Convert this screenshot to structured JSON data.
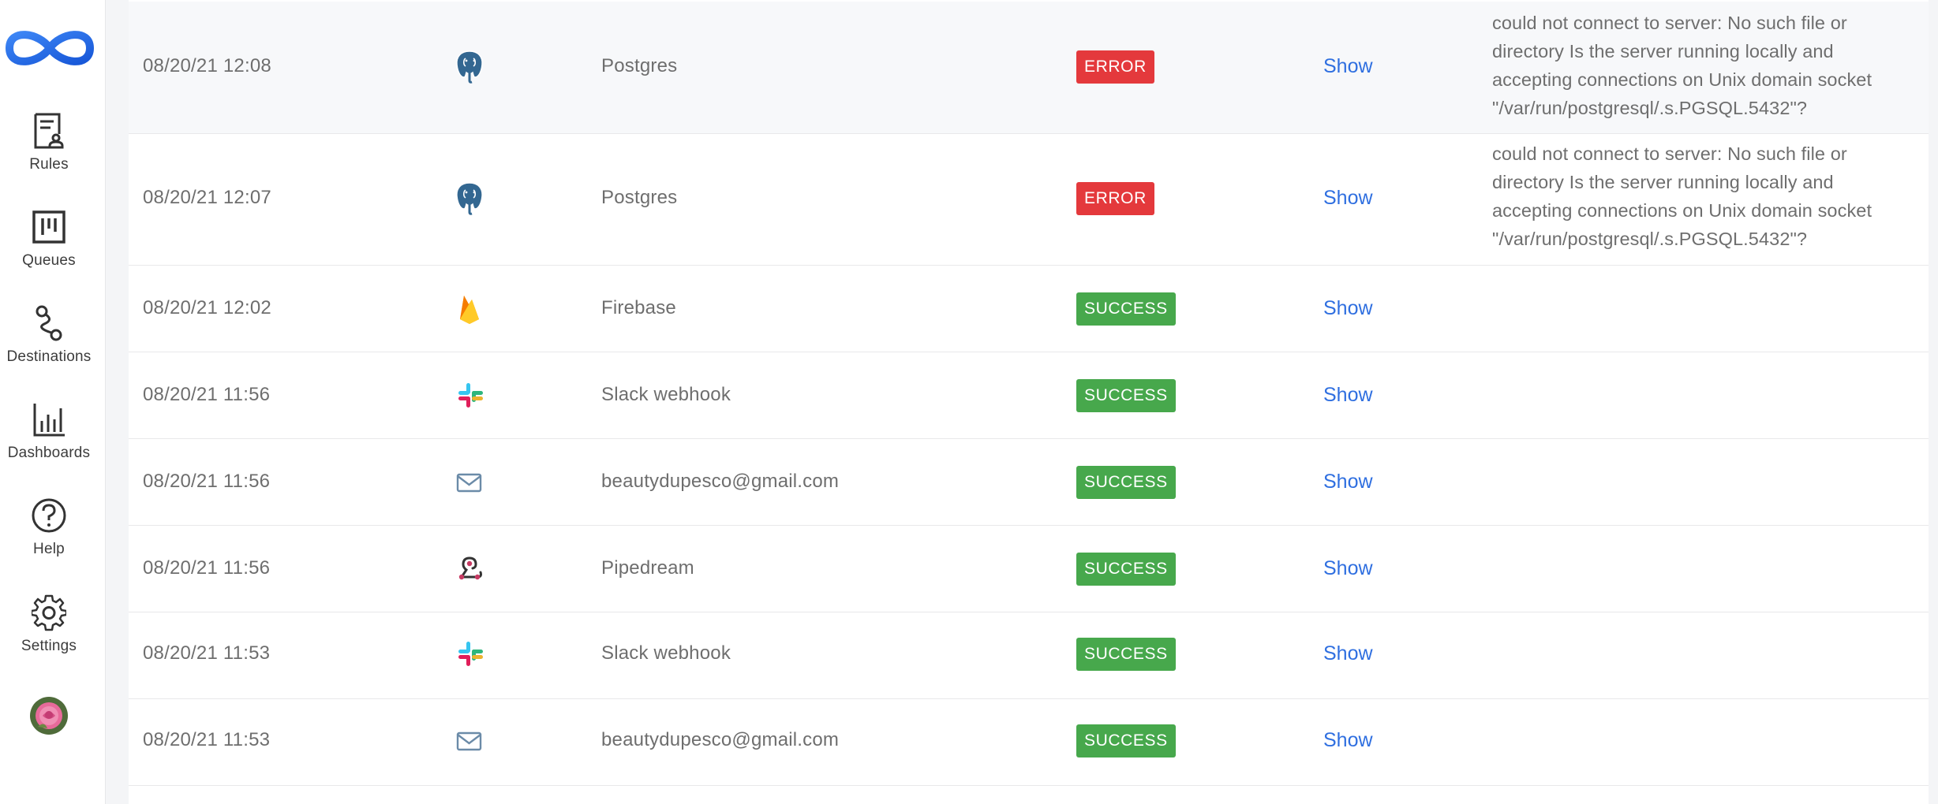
{
  "sidebar": {
    "logo_icon": "infinity-logo-icon",
    "items": [
      {
        "label": "Rules",
        "icon": "rules-icon"
      },
      {
        "label": "Queues",
        "icon": "queues-icon"
      },
      {
        "label": "Destinations",
        "icon": "destinations-icon"
      },
      {
        "label": "Dashboards",
        "icon": "dashboards-icon"
      },
      {
        "label": "Help",
        "icon": "help-icon"
      },
      {
        "label": "Settings",
        "icon": "settings-icon"
      }
    ],
    "avatar_icon": "rose-avatar-icon"
  },
  "colors": {
    "error": "#e4393c",
    "success": "#47a84c",
    "link": "#2f6fe0",
    "logo": "#1f6fe5"
  },
  "log": {
    "rows": [
      {
        "date": "08/20/21 12:08",
        "icon": "postgres-icon",
        "name": "Postgres",
        "status": "ERROR",
        "action": "Show",
        "message": "could not connect to server: No such file or directory Is the server running locally and accepting connections on Unix domain socket \"/var/run/postgresql/.s.PGSQL.5432\"?"
      },
      {
        "date": "08/20/21 12:07",
        "icon": "postgres-icon",
        "name": "Postgres",
        "status": "ERROR",
        "action": "Show",
        "message": "could not connect to server: No such file or directory Is the server running locally and accepting connections on Unix domain socket \"/var/run/postgresql/.s.PGSQL.5432\"?"
      },
      {
        "date": "08/20/21 12:02",
        "icon": "firebase-icon",
        "name": "Firebase",
        "status": "SUCCESS",
        "action": "Show",
        "message": ""
      },
      {
        "date": "08/20/21 11:56",
        "icon": "slack-icon",
        "name": "Slack webhook",
        "status": "SUCCESS",
        "action": "Show",
        "message": ""
      },
      {
        "date": "08/20/21 11:56",
        "icon": "email-icon",
        "name": "beautydupesco@gmail.com",
        "status": "SUCCESS",
        "action": "Show",
        "message": ""
      },
      {
        "date": "08/20/21 11:56",
        "icon": "pipedream-webhook-icon",
        "name": "Pipedream",
        "status": "SUCCESS",
        "action": "Show",
        "message": ""
      },
      {
        "date": "08/20/21 11:53",
        "icon": "slack-icon",
        "name": "Slack webhook",
        "status": "SUCCESS",
        "action": "Show",
        "message": ""
      },
      {
        "date": "08/20/21 11:53",
        "icon": "email-icon",
        "name": "beautydupesco@gmail.com",
        "status": "SUCCESS",
        "action": "Show",
        "message": ""
      }
    ]
  }
}
